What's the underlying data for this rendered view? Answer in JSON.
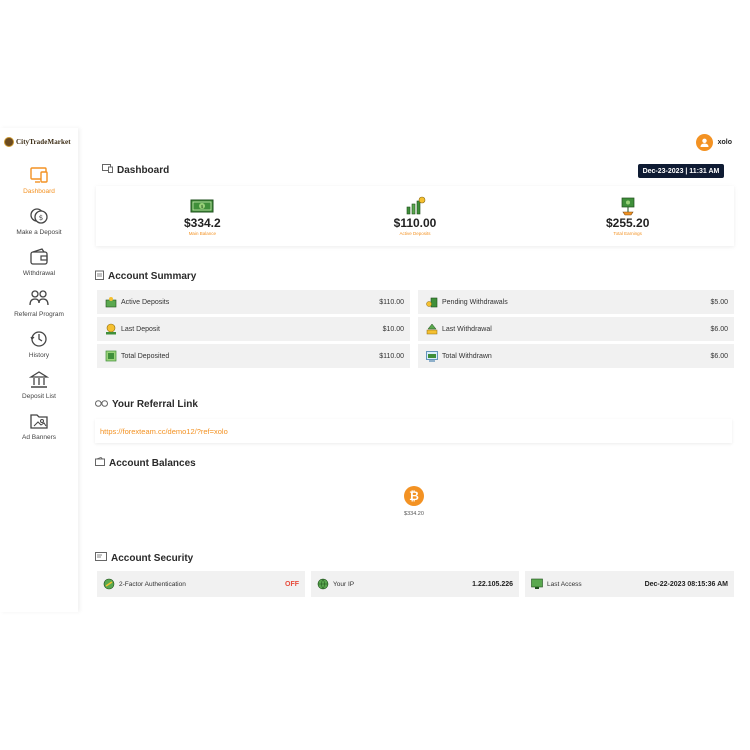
{
  "brand": {
    "name": "CityTradeMarket"
  },
  "user": {
    "name": "xolo"
  },
  "nav": [
    {
      "label": "Dashboard",
      "icon": "dashboard-icon",
      "active": true
    },
    {
      "label": "Make a Deposit",
      "icon": "coin-deposit-icon"
    },
    {
      "label": "Withdrawal",
      "icon": "wallet-icon"
    },
    {
      "label": "Referral Program",
      "icon": "referral-users-icon"
    },
    {
      "label": "History",
      "icon": "history-clock-icon"
    },
    {
      "label": "Deposit List",
      "icon": "bank-icon"
    },
    {
      "label": "Ad Banners",
      "icon": "image-folder-icon"
    }
  ],
  "dashboard": {
    "title": "Dashboard",
    "datetime": "Dec-23-2023 | 11:31 AM",
    "stats": [
      {
        "value": "$334.2",
        "label": "Main Balance",
        "icon": "banknote-icon"
      },
      {
        "value": "$110.00",
        "label": "Active Deposits",
        "icon": "bar-growth-icon"
      },
      {
        "value": "$255.20",
        "label": "Total Earnings",
        "icon": "money-plant-icon"
      }
    ]
  },
  "summary": {
    "title": "Account Summary",
    "rows": [
      {
        "label": "Active Deposits",
        "value": "$110.00",
        "icon": "active-deposit-icon"
      },
      {
        "label": "Pending Withdrawals",
        "value": "$5.00",
        "icon": "pending-withdraw-icon"
      },
      {
        "label": "Last Deposit",
        "value": "$10.00",
        "icon": "last-deposit-icon"
      },
      {
        "label": "Last Withdrawal",
        "value": "$6.00",
        "icon": "last-withdraw-icon"
      },
      {
        "label": "Total Deposited",
        "value": "$110.00",
        "icon": "total-deposit-icon"
      },
      {
        "label": "Total Withdrawn",
        "value": "$6.00",
        "icon": "total-withdraw-icon"
      }
    ]
  },
  "referral": {
    "title": "Your Referral Link",
    "link": "https://forexteam.cc/demo12/?ref=xolo"
  },
  "balances": {
    "title": "Account Balances",
    "items": [
      {
        "currency": "bitcoin",
        "symbol": "₿",
        "amount": "$334.20"
      }
    ]
  },
  "security": {
    "title": "Account Security",
    "two_factor": {
      "label": "2-Factor Authentication",
      "value": "OFF"
    },
    "ip": {
      "label": "Your IP",
      "value": "1.22.105.226"
    },
    "last_access": {
      "label": "Last Access",
      "value": "Dec-22-2023 08:15:36 AM"
    }
  },
  "colors": {
    "accent": "#f39223",
    "dark": "#0f1b33",
    "off": "#e74c3c",
    "row_bg": "#f1f1f1"
  }
}
